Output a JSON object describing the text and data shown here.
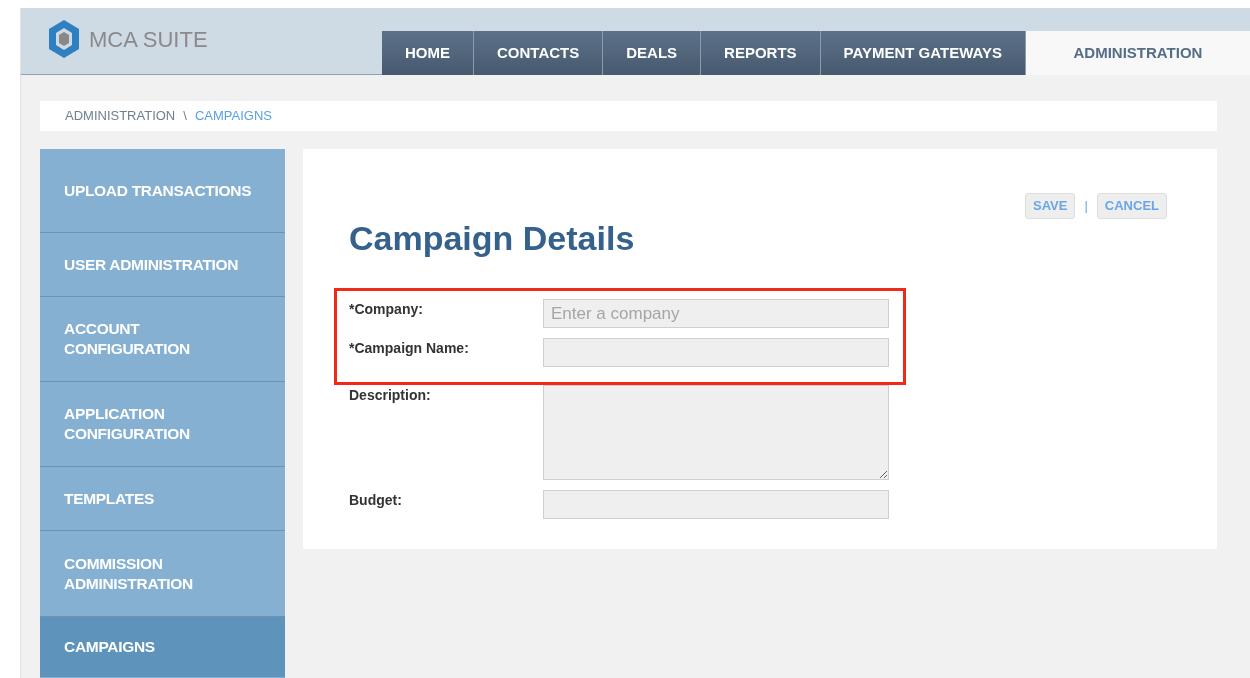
{
  "app": {
    "name": "MCA SUITE"
  },
  "nav_tabs": [
    {
      "label": "HOME",
      "selected": false
    },
    {
      "label": "CONTACTS",
      "selected": false
    },
    {
      "label": "DEALS",
      "selected": false
    },
    {
      "label": "REPORTS",
      "selected": false
    },
    {
      "label": "PAYMENT GATEWAYS",
      "selected": false
    },
    {
      "label": "ADMINISTRATION",
      "selected": true
    }
  ],
  "breadcrumb": [
    {
      "label": "ADMINISTRATION",
      "current": false
    },
    {
      "label": "CAMPAIGNS",
      "current": true
    }
  ],
  "breadcrumb_separator": "\\",
  "sidebar": {
    "items": [
      {
        "label": "UPLOAD TRANSACTIONS",
        "selected": false
      },
      {
        "label": "USER ADMINISTRATION",
        "selected": false
      },
      {
        "label": "ACCOUNT CONFIGURATION",
        "selected": false
      },
      {
        "label": "APPLICATION CONFIGURATION",
        "selected": false
      },
      {
        "label": "TEMPLATES",
        "selected": false
      },
      {
        "label": "COMMISSION ADMINISTRATION",
        "selected": false
      },
      {
        "label": "CAMPAIGNS",
        "selected": true
      }
    ]
  },
  "form": {
    "title": "Campaign Details",
    "actions": [
      "SAVE",
      "CANCEL"
    ],
    "action_separator": "|",
    "fields": [
      {
        "label": "*Company:",
        "kind": "input",
        "placeholder": "Enter a company",
        "highlighted": true
      },
      {
        "label": "*Campaign Name:",
        "kind": "input",
        "highlighted": true
      },
      {
        "label": "Description:",
        "kind": "textarea",
        "highlighted": false
      },
      {
        "label": "Budget:",
        "kind": "input",
        "highlighted": false
      }
    ]
  }
}
